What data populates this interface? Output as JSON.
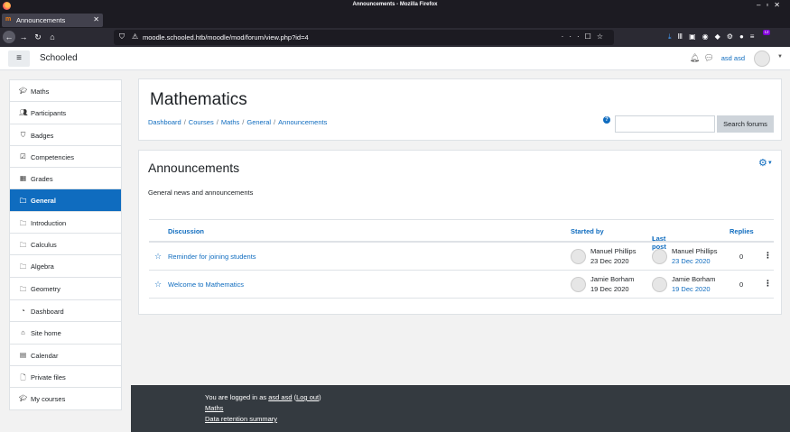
{
  "browser": {
    "window_title": "Announcements - Mozilla Firefox",
    "tab_title": "Announcements",
    "new_tab_label": "+",
    "url": "moodle.schooled.htb/moodle/mod/forum/view.php?id=4",
    "extension_badge": "12"
  },
  "header": {
    "site_name": "Schooled",
    "user_name": "asd asd"
  },
  "sidebar": {
    "course_items": [
      {
        "icon": "graduation-cap-icon",
        "label": "Maths"
      },
      {
        "icon": "users-icon",
        "label": "Participants"
      },
      {
        "icon": "shield-icon",
        "label": "Badges"
      },
      {
        "icon": "checkbox-icon",
        "label": "Competencies"
      },
      {
        "icon": "table-icon",
        "label": "Grades"
      },
      {
        "icon": "folder-icon",
        "label": "General",
        "active": true
      },
      {
        "icon": "folder-icon",
        "label": "Introduction"
      },
      {
        "icon": "folder-icon",
        "label": "Calculus"
      },
      {
        "icon": "folder-icon",
        "label": "Algebra"
      },
      {
        "icon": "folder-icon",
        "label": "Geometry"
      }
    ],
    "site_items": [
      {
        "icon": "dashboard-icon",
        "label": "Dashboard"
      },
      {
        "icon": "home-icon",
        "label": "Site home"
      },
      {
        "icon": "calendar-icon",
        "label": "Calendar"
      },
      {
        "icon": "file-icon",
        "label": "Private files"
      },
      {
        "icon": "graduation-cap-icon",
        "label": "My courses"
      }
    ]
  },
  "course": {
    "title": "Mathematics",
    "breadcrumb": [
      "Dashboard",
      "Courses",
      "Maths",
      "General",
      "Announcements"
    ],
    "help_icon": "?",
    "search_placeholder": "",
    "search_button": "Search forums"
  },
  "forum": {
    "title": "Announcements",
    "intro": "General news and announcements",
    "columns": {
      "discussion": "Discussion",
      "started_by": "Started by",
      "last_post": "Last post",
      "replies": "Replies"
    },
    "discussions": [
      {
        "subject": "Reminder for joining students",
        "started_by": "Manuel Phillips",
        "started_date": "23 Dec 2020",
        "last_post_by": "Manuel Phillips",
        "last_post_date": "23 Dec 2020",
        "replies": "0"
      },
      {
        "subject": "Welcome to Mathematics",
        "started_by": "Jamie Borham",
        "started_date": "19 Dec 2020",
        "last_post_by": "Jamie Borham",
        "last_post_date": "19 Dec 2020",
        "replies": "0"
      }
    ]
  },
  "footer": {
    "logged_in_prefix": "You are logged in as",
    "logged_in_user": "asd asd",
    "logout_label": "Log out",
    "course_link": "Maths",
    "data_retention": "Data retention summary"
  },
  "colors": {
    "primary": "#0f6cbf",
    "footer_bg": "#343a40",
    "page_bg": "#f2f2f2"
  }
}
